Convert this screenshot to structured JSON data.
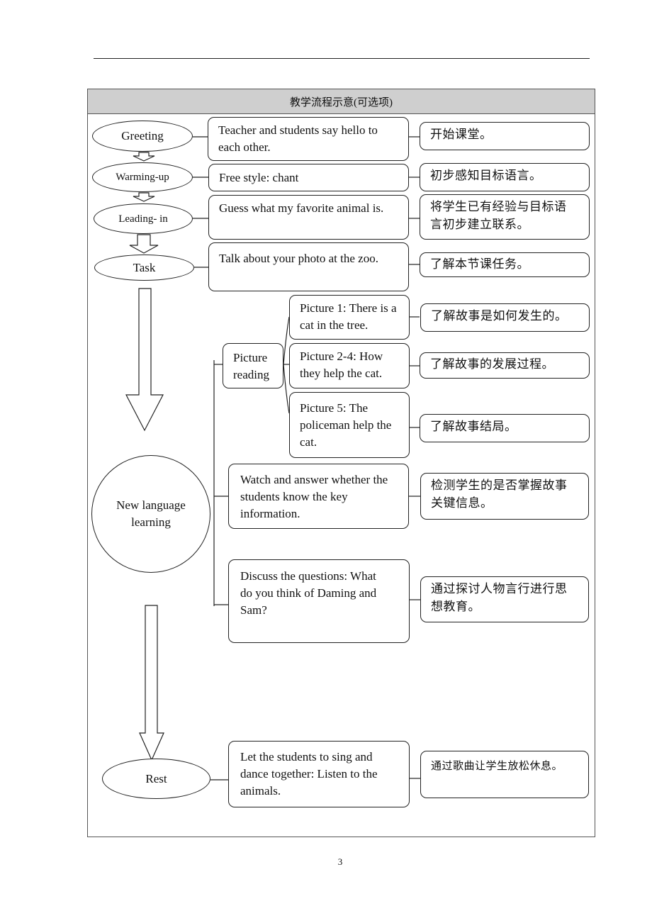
{
  "document": {
    "page_number": "3",
    "table_header": "教学流程示意(可选项)"
  },
  "stages": [
    {
      "label": "Greeting"
    },
    {
      "label": "Warming-up"
    },
    {
      "label": "Leading- in"
    },
    {
      "label": "Task"
    },
    {
      "label": "New language learning"
    },
    {
      "label": "Rest"
    }
  ],
  "activities": {
    "greeting": "Teacher and students say hello to each other.",
    "warming_up": "Free style: chant",
    "leading_in": "Guess what my favorite animal is.",
    "task": "Talk about your photo at the zoo.",
    "picture_reading": "Picture reading",
    "picture_1": "Picture 1: There is a cat in the tree.",
    "picture_2_4": "Picture 2-4: How they help the cat.",
    "picture_5": "Picture 5: The policeman help the cat.",
    "watch_answer": "Watch and answer whether the students know the key information.",
    "discuss": "Discuss the questions: What do you think of Daming and Sam?",
    "rest": "Let the students to sing and dance together: Listen to the animals."
  },
  "purposes": {
    "greeting": "开始课堂。",
    "warming_up": "初步感知目标语言。",
    "leading_in": "将学生已有经验与目标语言初步建立联系。",
    "task": "了解本节课任务。",
    "picture_1": "了解故事是如何发生的。",
    "picture_2_4": "了解故事的发展过程。",
    "picture_5": "了解故事结局。",
    "watch_answer": "检测学生的是否掌握故事关键信息。",
    "discuss": "通过探讨人物言行进行思想教育。",
    "rest": "通过歌曲让学生放松休息。"
  }
}
